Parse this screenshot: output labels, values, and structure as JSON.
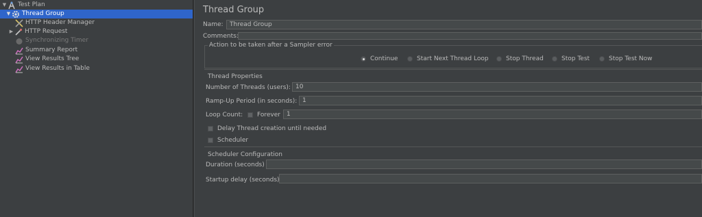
{
  "tree": {
    "items": [
      {
        "label": "Test Plan",
        "icon": "test-plan-icon"
      },
      {
        "label": "Thread Group",
        "icon": "gear-icon"
      },
      {
        "label": "HTTP Header Manager",
        "icon": "wrench-icon"
      },
      {
        "label": "HTTP Request",
        "icon": "pipette-icon"
      },
      {
        "label": "Synchronizing Timer",
        "icon": "stopwatch-icon"
      },
      {
        "label": "Summary Report",
        "icon": "chart-icon"
      },
      {
        "label": "View Results Tree",
        "icon": "chart-icon"
      },
      {
        "label": "View Results in Table",
        "icon": "chart-icon"
      }
    ]
  },
  "panel": {
    "title": "Thread Group",
    "name_label": "Name:",
    "name_value": "Thread Group",
    "comments_label": "Comments:",
    "comments_value": "",
    "sampler_error": {
      "legend": "Action to be taken after a Sampler error",
      "options": [
        "Continue",
        "Start Next Thread Loop",
        "Stop Thread",
        "Stop Test",
        "Stop Test Now"
      ],
      "selected": "Continue"
    },
    "thread_properties": {
      "legend": "Thread Properties",
      "threads_label": "Number of Threads (users):",
      "threads_value": "10",
      "rampup_label": "Ramp-Up Period (in seconds):",
      "rampup_value": "1",
      "loop_label": "Loop Count:",
      "forever_label": "Forever",
      "loop_value": "1",
      "delay_label": "Delay Thread creation until needed",
      "scheduler_label": "Scheduler"
    },
    "scheduler_config": {
      "legend": "Scheduler Configuration",
      "duration_label": "Duration (seconds)",
      "duration_value": "",
      "startup_label": "Startup delay (seconds)",
      "startup_value": ""
    }
  }
}
